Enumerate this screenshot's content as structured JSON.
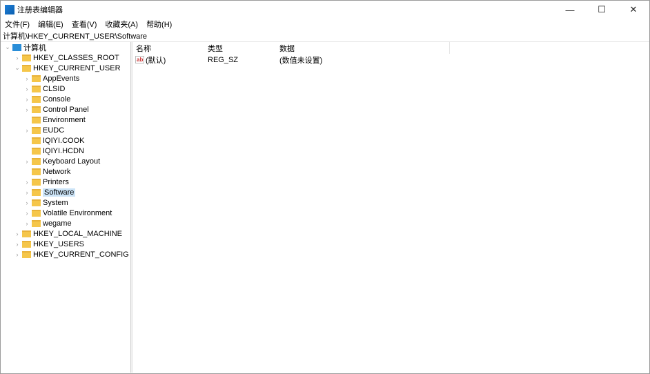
{
  "window": {
    "title": "注册表编辑器",
    "minimize": "—",
    "maximize": "☐",
    "close": "✕"
  },
  "menu": [
    "文件(F)",
    "编辑(E)",
    "查看(V)",
    "收藏夹(A)",
    "帮助(H)"
  ],
  "address": "计算机\\HKEY_CURRENT_USER\\Software",
  "tree": {
    "root": "计算机",
    "hives": [
      "HKEY_CLASSES_ROOT",
      "HKEY_CURRENT_USER",
      "HKEY_LOCAL_MACHINE",
      "HKEY_USERS",
      "HKEY_CURRENT_CONFIG"
    ],
    "hkcu_children": [
      "AppEvents",
      "CLSID",
      "Console",
      "Control Panel",
      "Environment",
      "EUDC",
      "IQIYI.COOK",
      "IQIYI.HCDN",
      "Keyboard Layout",
      "Network",
      "Printers",
      "Software",
      "System",
      "Volatile Environment",
      "wegame"
    ],
    "selected": "Software"
  },
  "columns": [
    "名称",
    "类型",
    "数据"
  ],
  "values": [
    {
      "name": "(默认)",
      "type": "REG_SZ",
      "data": "(数值未设置)",
      "icon": "ab"
    }
  ]
}
